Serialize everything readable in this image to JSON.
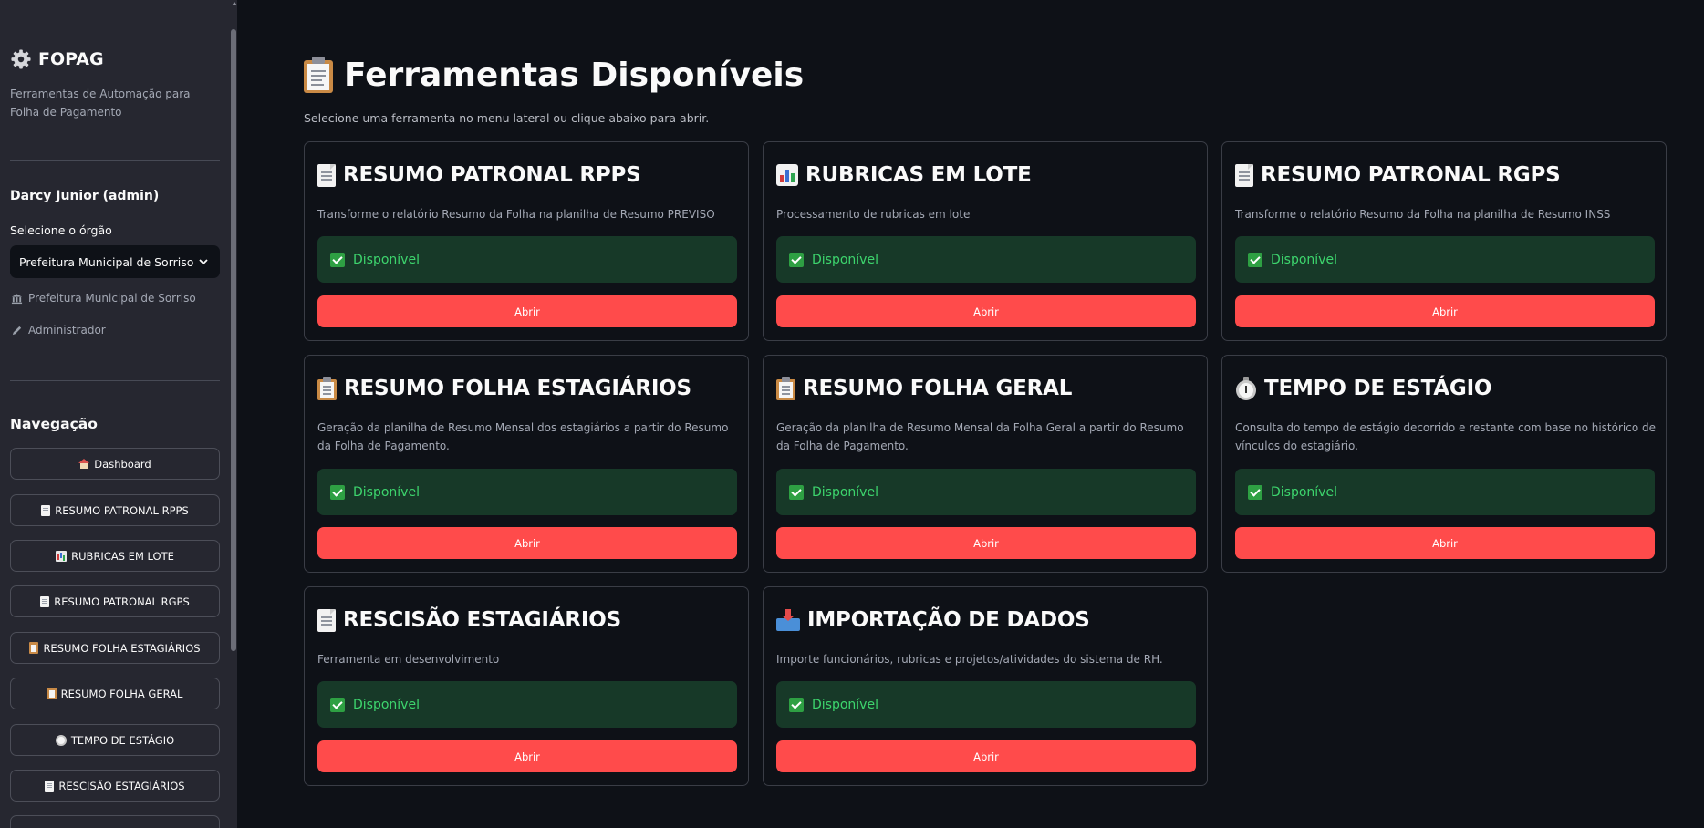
{
  "sidebar": {
    "brand_title": "FOPAG",
    "brand_icon": "gear-icon",
    "brand_subtitle": "Ferramentas de Automação para Folha de Pagamento",
    "user_name": "Darcy Junior (admin)",
    "org_label": "Selecione o órgão",
    "org_selected": "Prefeitura Municipal de Sorriso",
    "org_info": "Prefeitura Municipal de Sorriso",
    "role_info": "Administrador",
    "nav_title": "Navegação",
    "nav_items": [
      {
        "label": "Dashboard",
        "icon": "house-icon"
      },
      {
        "label": "RESUMO PATRONAL RPPS",
        "icon": "document-icon"
      },
      {
        "label": "RUBRICAS EM LOTE",
        "icon": "bar-chart-icon"
      },
      {
        "label": "RESUMO PATRONAL RGPS",
        "icon": "document-icon"
      },
      {
        "label": "RESUMO FOLHA ESTAGIÁRIOS",
        "icon": "clipboard-icon"
      },
      {
        "label": "RESUMO FOLHA GERAL",
        "icon": "clipboard-icon"
      },
      {
        "label": "TEMPO DE ESTÁGIO",
        "icon": "stopwatch-icon"
      },
      {
        "label": "RESCISÃO ESTAGIÁRIOS",
        "icon": "document-icon"
      }
    ]
  },
  "main": {
    "title": "Ferramentas Disponíveis",
    "subtitle": "Selecione uma ferramenta no menu lateral ou clique abaixo para abrir.",
    "status_label": "Disponível",
    "open_label": "Abrir",
    "cards": [
      {
        "title": "RESUMO PATRONAL RPPS",
        "icon": "document-icon",
        "description": "Transforme o relatório Resumo da Folha na planilha de Resumo PREVISO"
      },
      {
        "title": "RUBRICAS EM LOTE",
        "icon": "bar-chart-icon",
        "description": "Processamento de rubricas em lote"
      },
      {
        "title": "RESUMO PATRONAL RGPS",
        "icon": "document-icon",
        "description": "Transforme o relatório Resumo da Folha na planilha de Resumo INSS"
      },
      {
        "title": "RESUMO FOLHA ESTAGIÁRIOS",
        "icon": "clipboard-icon",
        "description": "Geração da planilha de Resumo Mensal dos estagiários a partir do Resumo da Folha de Pagamento."
      },
      {
        "title": "RESUMO FOLHA GERAL",
        "icon": "clipboard-icon",
        "description": "Geração da planilha de Resumo Mensal da Folha Geral a partir do Resumo da Folha de Pagamento."
      },
      {
        "title": "TEMPO DE ESTÁGIO",
        "icon": "stopwatch-icon",
        "description": "Consulta do tempo de estágio decorrido e restante com base no histórico de vínculos do estagiário."
      },
      {
        "title": "RESCISÃO ESTAGIÁRIOS",
        "icon": "document-icon",
        "description": "Ferramenta em desenvolvimento"
      },
      {
        "title": "IMPORTAÇÃO DE DADOS",
        "icon": "inbox-tray-icon",
        "description": "Importe funcionários, rubricas e projetos/atividades do sistema de RH."
      }
    ]
  },
  "colors": {
    "background": "#0e1117",
    "sidebar": "#262730",
    "primary_button": "#ff4b4b",
    "success_bg": "#173928",
    "success_text": "#3dd56d"
  }
}
